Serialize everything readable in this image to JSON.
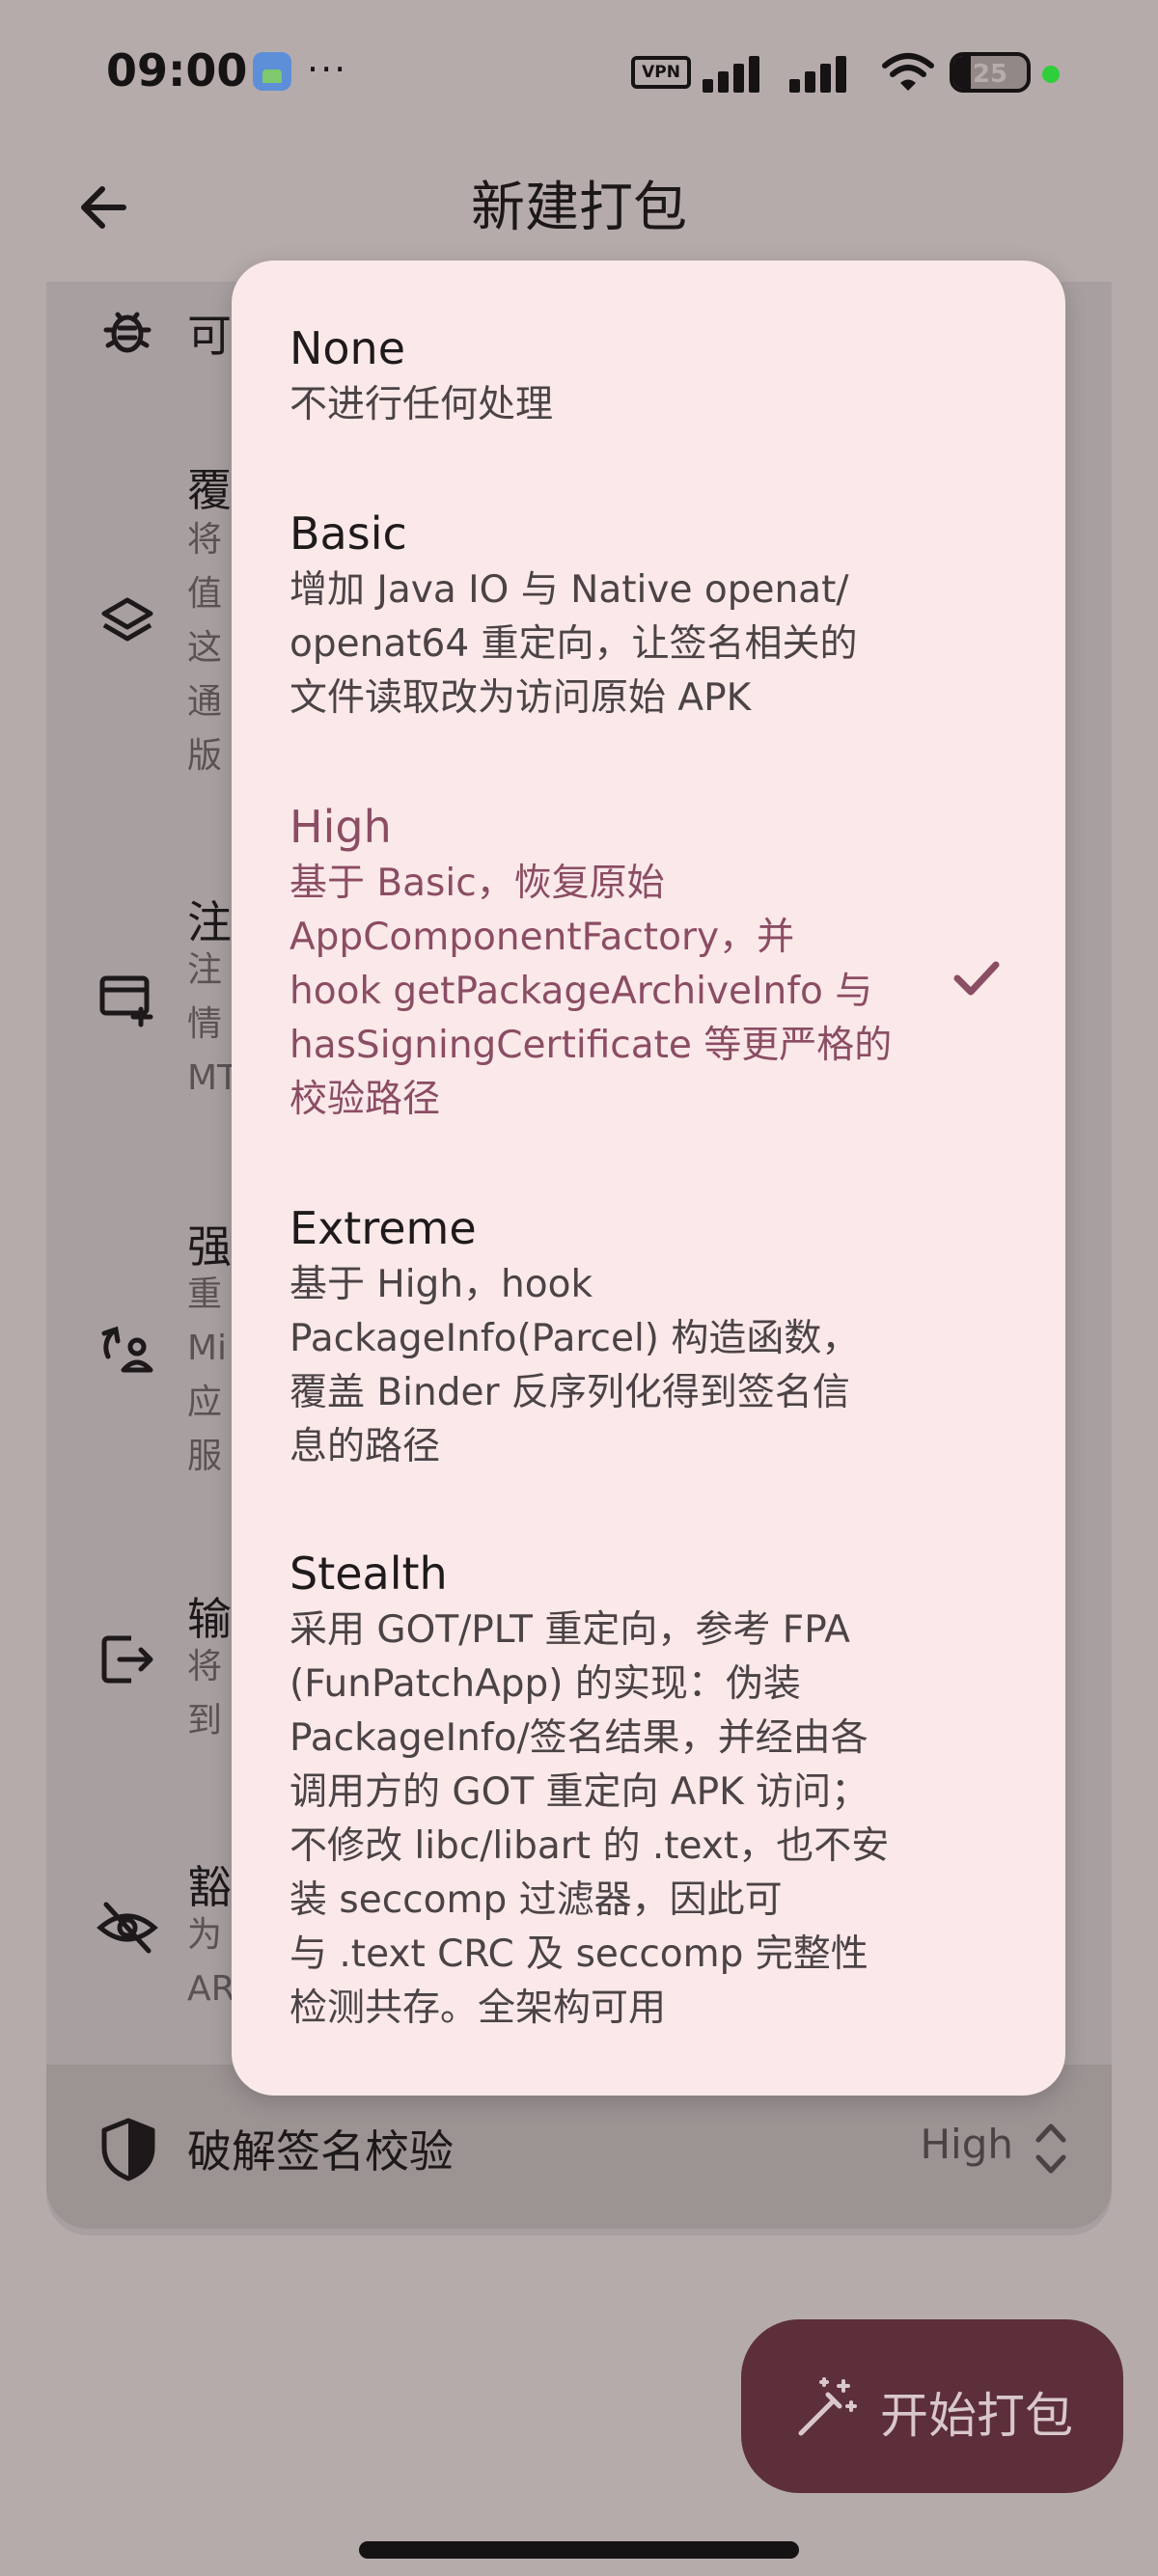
{
  "status_bar": {
    "time": "09:00",
    "more": "···",
    "vpn": "VPN",
    "battery": "25"
  },
  "app_bar": {
    "title": "新建打包"
  },
  "background_settings": {
    "items": [
      {
        "title": "可",
        "desc": ""
      },
      {
        "title": "覆",
        "desc": "将\n值\n这\n通\n版"
      },
      {
        "title": "注",
        "desc": "注\n情\nMT"
      },
      {
        "title": "强",
        "desc": "重\nMi\n应\n服"
      },
      {
        "title": "输",
        "desc": "将\n到"
      },
      {
        "title": "豁",
        "desc": "为\nAR"
      }
    ],
    "bypass": {
      "label": "破解签名校验",
      "value": "High"
    }
  },
  "menu": {
    "options": [
      {
        "label": "None",
        "desc": "不进行任何处理",
        "selected": false
      },
      {
        "label": "Basic",
        "desc": "增加 Java IO 与 Native openat/\nopenat64 重定向，让签名相关的\n文件读取改为访问原始 APK",
        "selected": false
      },
      {
        "label": "High",
        "desc": "基于 Basic，恢复原始\nAppComponentFactory，并\nhook getPackageArchiveInfo 与\nhasSigningCertificate 等更严格的\n校验路径",
        "selected": true
      },
      {
        "label": "Extreme",
        "desc": "基于 High，hook\nPackageInfo(Parcel) 构造函数，\n覆盖 Binder 反序列化得到签名信\n息的路径",
        "selected": false
      },
      {
        "label": "Stealth",
        "desc": "采用 GOT/PLT 重定向，参考 FPA\n(FunPatchApp) 的实现：伪装\nPackageInfo/签名结果，并经由各\n调用方的 GOT 重定向 APK 访问；\n不修改 libc/libart 的 .text，也不安\n装 seccomp 过滤器，因此可\n与 .text CRC 及 seccomp 完整性\n检测共存。全架构可用",
        "selected": false
      }
    ]
  },
  "fab": {
    "label": "开始打包"
  },
  "colors": {
    "scrim_bg": "#b6abab",
    "menu_bg": "#fbe9ea",
    "accent": "#8b4d63",
    "fab_bg": "#5c2f3b"
  }
}
